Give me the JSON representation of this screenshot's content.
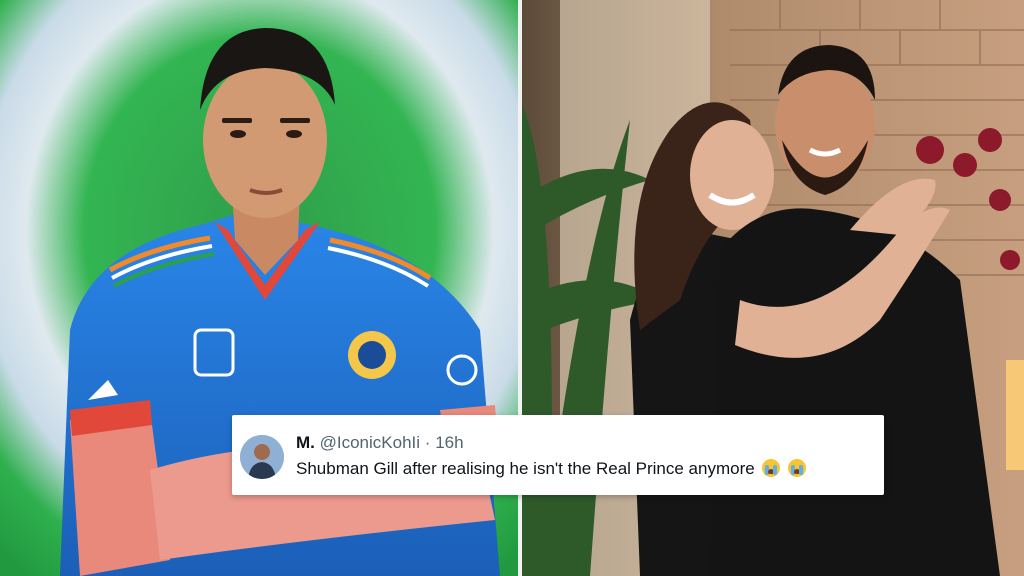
{
  "left_photo": {
    "subject": "cricketer-in-blue-jersey"
  },
  "right_photo": {
    "subject": "couple-embracing"
  },
  "tweet": {
    "display_name": "M.",
    "handle": "@IconicKohIi",
    "separator": "·",
    "time_ago": "16h",
    "text": "Shubman Gill after realising he isn't the Real Prince anymore",
    "emojis": [
      "loudly-crying-face",
      "loudly-crying-face"
    ]
  },
  "colors": {
    "jersey_blue": "#1f74d6",
    "background_green": "#2eaf4a",
    "card_background": "#ffffff",
    "handle_gray": "#536471"
  }
}
